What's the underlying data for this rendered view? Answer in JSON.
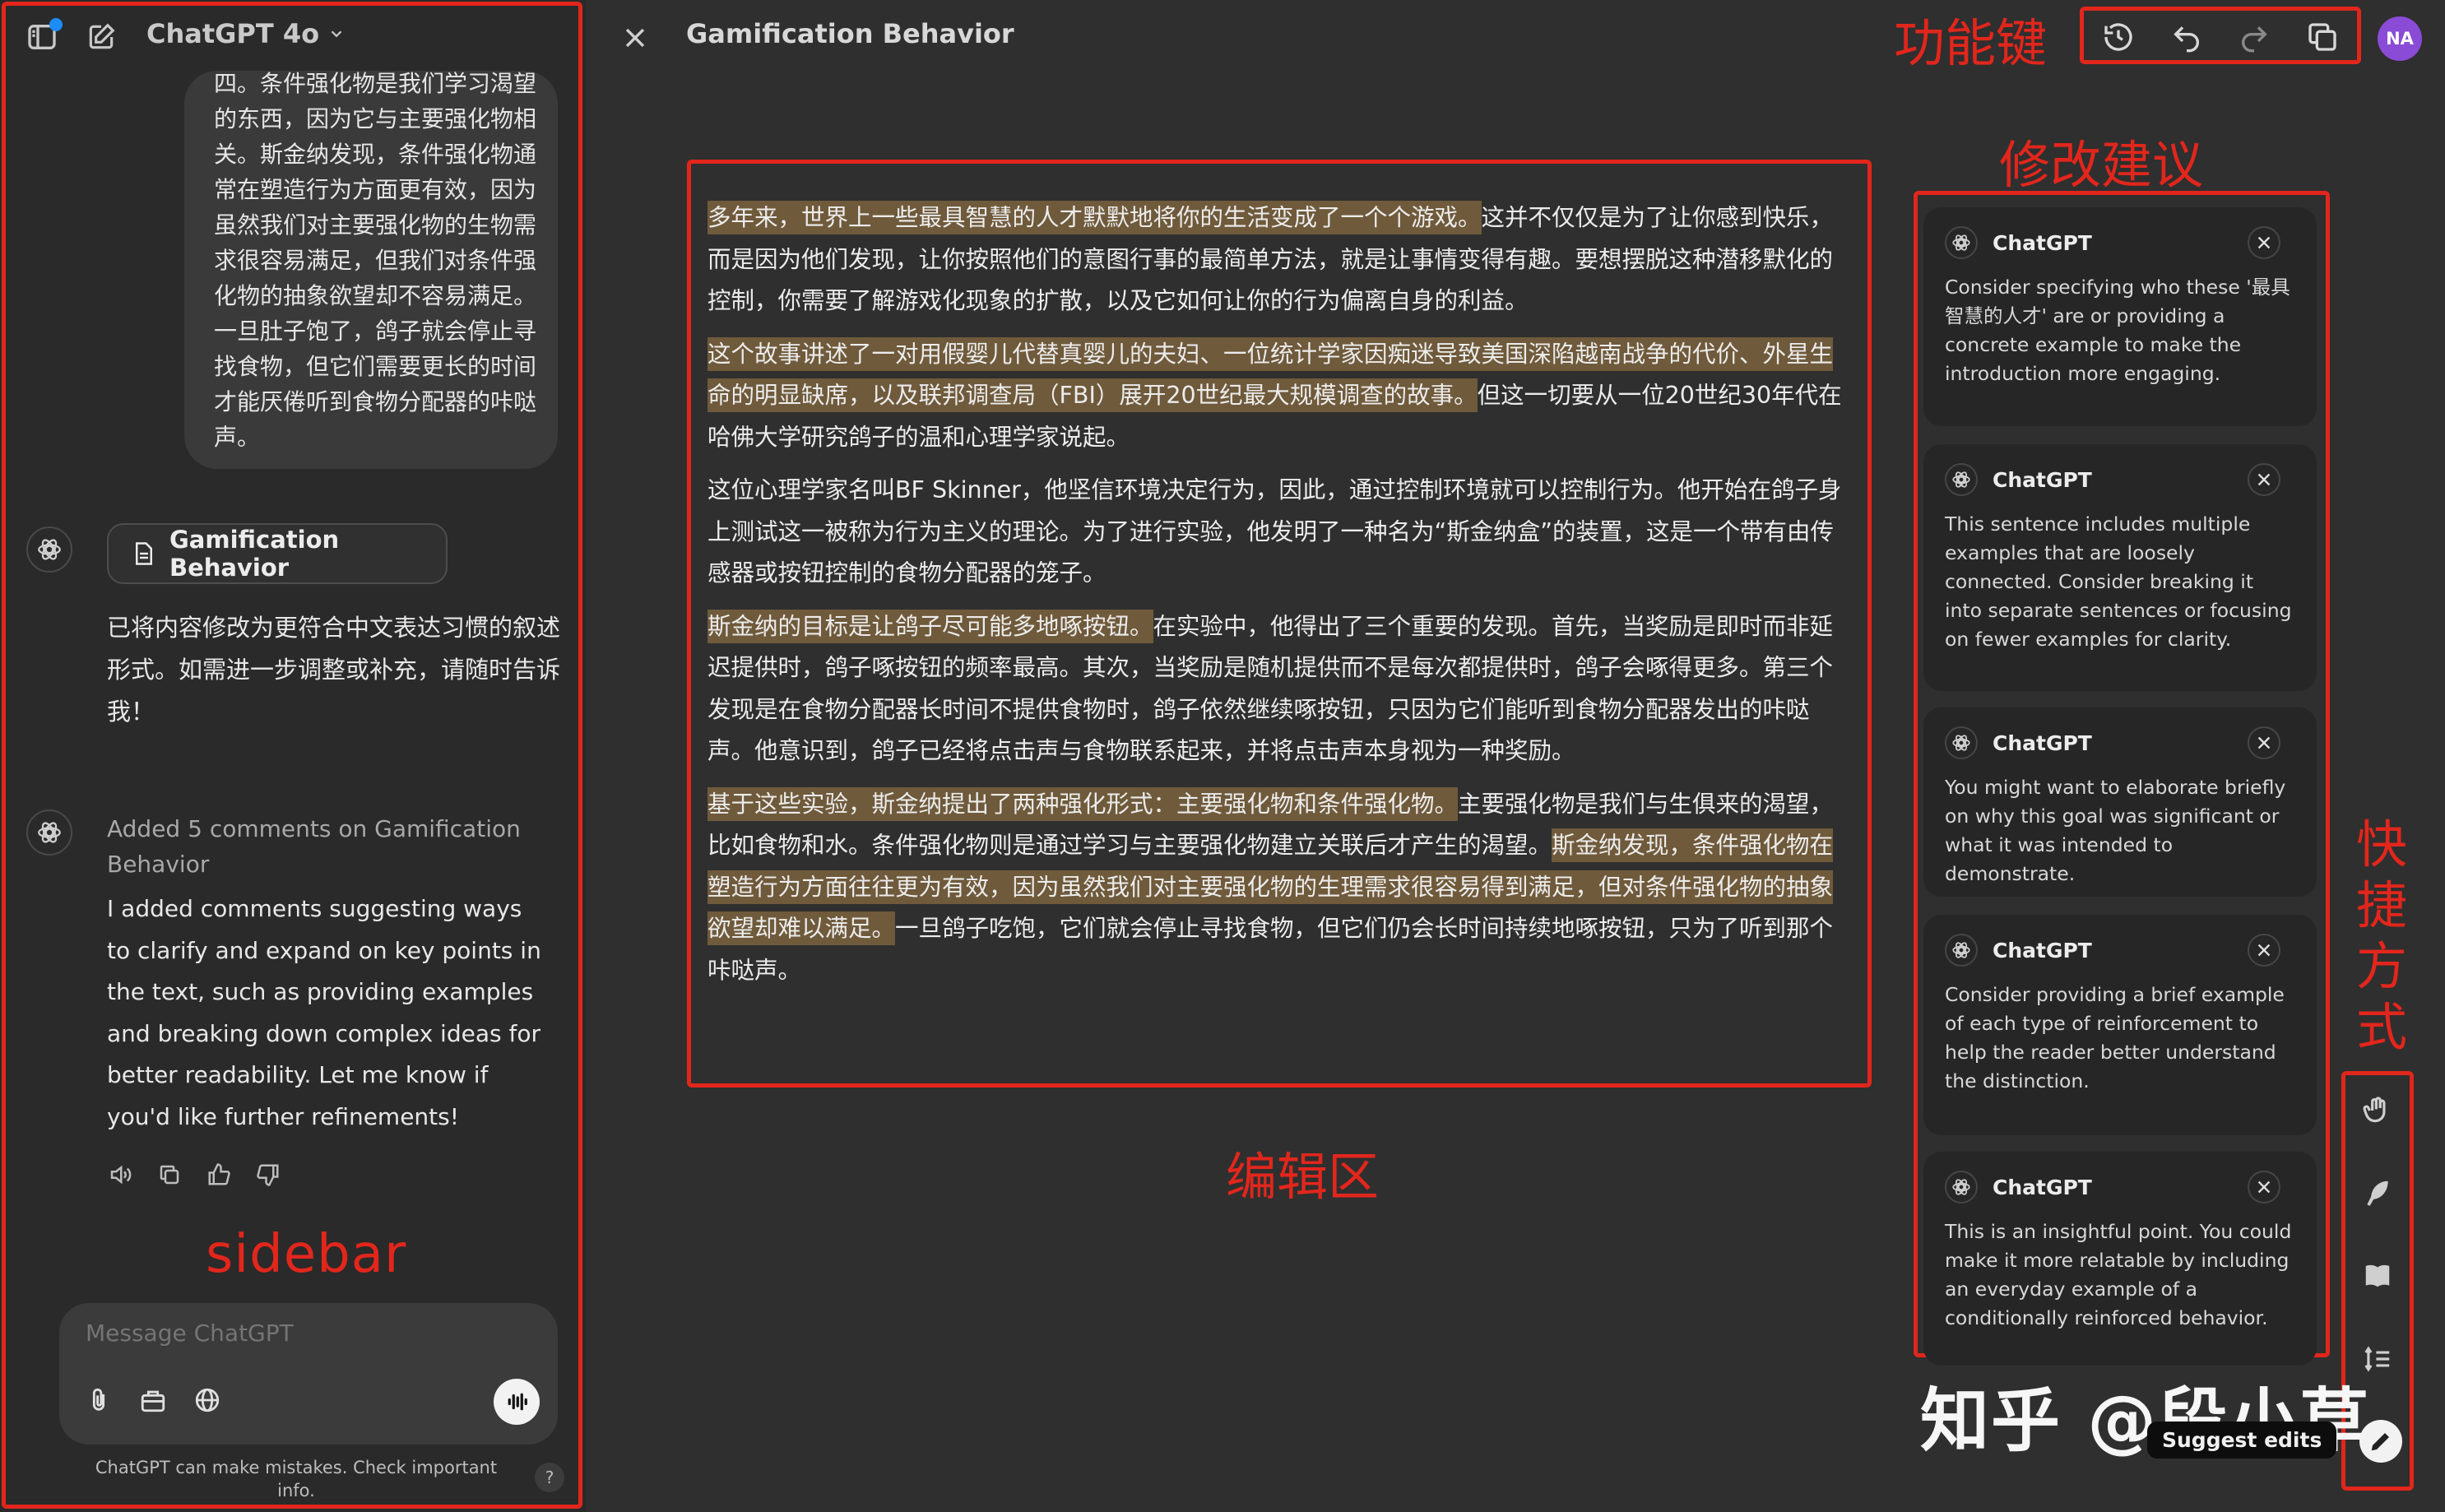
{
  "sidebar": {
    "model_name": "ChatGPT 4o",
    "user_message": "四。条件强化物是我们学习渴望的东西，因为它与主要强化物相关。斯金纳发现，条件强化物通常在塑造行为方面更有效，因为虽然我们对主要强化物的生物需求很容易满足，但我们对条件强化物的抽象欲望却不容易满足。一旦肚子饱了，鸽子就会停止寻找食物，但它们需要更长的时间才能厌倦听到食物分配器的咔哒声。",
    "doc_chip": "Gamification Behavior",
    "assistant_reply_1": "已将内容修改为更符合中文表达习惯的叙述形式。如需进一步调整或补充，请随时告诉我！",
    "added_comments": "Added 5 comments on Gamification Behavior",
    "assistant_reply_2": "I added comments suggesting ways to clarify and expand on key points in the text, such as providing examples and breaking down complex ideas for better readability. Let me know if you'd like further refinements!",
    "composer_placeholder": "Message ChatGPT",
    "disclaimer": "ChatGPT can make mistakes. Check important info.",
    "help": "?",
    "annotation": "sidebar"
  },
  "canvas": {
    "title": "Gamification Behavior",
    "user_initials": "NA",
    "annotations": {
      "function_keys": "功能键",
      "suggestions": "修改建议",
      "editor": "编辑区",
      "shortcuts": "快捷方式"
    },
    "paragraphs": [
      [
        {
          "t": "多年来，世界上一些最具智慧的人才默默地将你的生活变成了一个个游戏。",
          "hl": true
        },
        {
          "t": "这并不仅仅是为了让你感到快乐，而是因为他们发现，让你按照他们的意图行事的最简单方法，就是让事情变得有趣。要想摆脱这种潜移默化的控制，你需要了解游戏化现象的扩散，以及它如何让你的行为偏离自身的利益。",
          "hl": false
        }
      ],
      [
        {
          "t": "这个故事讲述了一对用假婴儿代替真婴儿的夫妇、一位统计学家因痴迷导致美国深陷越南战争的代价、外星生命的明显缺席，以及联邦调查局（FBI）展开20世纪最大规模调查的故事。",
          "hl": true
        },
        {
          "t": "但这一切要从一位20世纪30年代在哈佛大学研究鸽子的温和心理学家说起。",
          "hl": false
        }
      ],
      [
        {
          "t": "这位心理学家名叫BF Skinner，他坚信环境决定行为，因此，通过控制环境就可以控制行为。他开始在鸽子身上测试这一被称为行为主义的理论。为了进行实验，他发明了一种名为“斯金纳盒”的装置，这是一个带有由传感器或按钮控制的食物分配器的笼子。",
          "hl": false
        }
      ],
      [
        {
          "t": "斯金纳的目标是让鸽子尽可能多地啄按钮。",
          "hl": true
        },
        {
          "t": "在实验中，他得出了三个重要的发现。首先，当奖励是即时而非延迟提供时，鸽子啄按钮的频率最高。其次，当奖励是随机提供而不是每次都提供时，鸽子会啄得更多。第三个发现是在食物分配器长时间不提供食物时，鸽子依然继续啄按钮，只因为它们能听到食物分配器发出的咔哒声。他意识到，鸽子已经将点击声与食物联系起来，并将点击声本身视为一种奖励。",
          "hl": false
        }
      ],
      [
        {
          "t": "基于这些实验，斯金纳提出了两种强化形式：主要强化物和条件强化物。",
          "hl": true
        },
        {
          "t": "主要强化物是我们与生俱来的渴望，比如食物和水。条件强化物则是通过学习与主要强化物建立关联后才产生的渴望。",
          "hl": false
        },
        {
          "t": "斯金纳发现，条件强化物在塑造行为方面往往更为有效，因为虽然我们对主要强化物的生理需求很容易得到满足，但对条件强化物的抽象欲望却难以满足。",
          "hl": true
        },
        {
          "t": "一旦鸽子吃饱，它们就会停止寻找食物，但它们仍会长时间持续地啄按钮，只为了听到那个咔哒声。",
          "hl": false
        }
      ]
    ],
    "comments": [
      {
        "author": "ChatGPT",
        "text": "Consider specifying who these '最具智慧的人才' are or providing a concrete example to make the introduction more engaging."
      },
      {
        "author": "ChatGPT",
        "text": "This sentence includes multiple examples that are loosely connected. Consider breaking it into separate sentences or focusing on fewer examples for clarity."
      },
      {
        "author": "ChatGPT",
        "text": "You might want to elaborate briefly on why this goal was significant or what it was intended to demonstrate."
      },
      {
        "author": "ChatGPT",
        "text": "Consider providing a brief example of each type of reinforcement to help the reader better understand the distinction."
      },
      {
        "author": "ChatGPT",
        "text": "This is an insightful point. You could make it more relatable by including an everyday example of a conditionally reinforced behavior."
      }
    ],
    "tooltip": "Suggest edits",
    "watermark": "知乎 @段小草"
  }
}
